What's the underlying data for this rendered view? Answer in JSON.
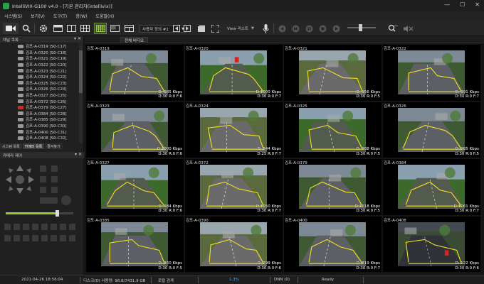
{
  "window": {
    "title": "IntelliVIX-G100 v4.0 - [기본 관리자(intellivix)]",
    "controls": [
      "—",
      "☐",
      "✕"
    ]
  },
  "menu": [
    "시스템(S)",
    "보기(V)",
    "도구(T)",
    "창(W)",
    "도움말(H)"
  ],
  "toolbar": {
    "layout_combo": "사용자 정의 #1",
    "view_label": "View 리스트"
  },
  "camera_list": {
    "header": "채널 목록",
    "items": [
      {
        "label": "김포-A-0319 [S0-C17]",
        "alert": false
      },
      {
        "label": "김포-A-0320 [S0-C18]",
        "alert": false
      },
      {
        "label": "김포-A-0321 [S0-C19]",
        "alert": false
      },
      {
        "label": "김포-A-0322 [S0-C20]",
        "alert": false
      },
      {
        "label": "김포-A-0323 [S0-C21]",
        "alert": false
      },
      {
        "label": "김포-A-0324 [S0-C22]",
        "alert": false
      },
      {
        "label": "김포-A-0325 [S0-C23]",
        "alert": false
      },
      {
        "label": "김포-A-0326 [S0-C24]",
        "alert": false
      },
      {
        "label": "김포-A-0327 [S0-C25]",
        "alert": false
      },
      {
        "label": "김포-A-0372 [S0-C26]",
        "alert": false
      },
      {
        "label": "김포-A-0379 [S0-C27]",
        "alert": true
      },
      {
        "label": "김포-A-0384 [S0-C28]",
        "alert": false
      },
      {
        "label": "김포-A-0385 [S0-C29]",
        "alert": false
      },
      {
        "label": "김포-A-0390 [S0-C30]",
        "alert": false
      },
      {
        "label": "김포-A-0400 [S0-C31]",
        "alert": false
      },
      {
        "label": "김포-A-0408 [S0-C32]",
        "alert": false
      }
    ]
  },
  "left_tabs": [
    "시스템 목록",
    "카메라 목록",
    "즐겨찾기"
  ],
  "ptz": {
    "header": "카메라 제어"
  },
  "main_tab": "전체 비디오",
  "cells": [
    {
      "name": "김포-A-0319",
      "stats": [
        "D: 985 Kbps",
        "D:30 R:0 F:6"
      ],
      "scene": "road"
    },
    {
      "name": "김포-A-0320",
      "stats": [
        "D:1000 Kbps",
        "D:30 R:0 F:7"
      ],
      "scene": "trees"
    },
    {
      "name": "김포-A-0321",
      "stats": [
        "D: 956 Kbps",
        "D:30 R:0 F:5"
      ],
      "scene": "street"
    },
    {
      "name": "김포-A-0322",
      "stats": [
        "D: 991 Kbps",
        "D:30 R:0 F:7"
      ],
      "scene": "road"
    },
    {
      "name": "김포-A-0323",
      "stats": [
        "D:1000 Kbps",
        "D:30 R:0 F:6"
      ],
      "scene": "road"
    },
    {
      "name": "김포-A-0324",
      "stats": [
        "D: 844 Kbps",
        "D:25 R:0 F:7"
      ],
      "scene": "street"
    },
    {
      "name": "김포-A-0325",
      "stats": [
        "D: 988 Kbps",
        "D:30 R:0 F:5"
      ],
      "scene": "trees"
    },
    {
      "name": "김포-A-0326",
      "stats": [
        "D: 985 Kbps",
        "D:30 R:0 F:5"
      ],
      "scene": "road"
    },
    {
      "name": "김포-A-0327",
      "stats": [
        "D: 984 Kbps",
        "D:30 R:0 F:6"
      ],
      "scene": "trees"
    },
    {
      "name": "김포-A-0372",
      "stats": [
        "D:1050 Kbps",
        "D:30 R:0 F:7"
      ],
      "scene": "street"
    },
    {
      "name": "김포-A-0379",
      "stats": [
        "D:1018 Kbps",
        "D:30 R:0 F:5"
      ],
      "scene": "road"
    },
    {
      "name": "김포-A-0384",
      "stats": [
        "D:1061 Kbps",
        "D:30 R:0 F:7"
      ],
      "scene": "trees"
    },
    {
      "name": "김포-A-0385",
      "stats": [
        "D: 360 Kbps",
        "D:30 R:0 F:5"
      ],
      "scene": "road"
    },
    {
      "name": "김포-A-0390",
      "stats": [
        "D: 299 Kbps",
        "D:30 R:0 F:6"
      ],
      "scene": "street"
    },
    {
      "name": "김포-A-0400",
      "stats": [
        "D: 819 Kbps",
        "D:30 R:0 F:7"
      ],
      "scene": "road"
    },
    {
      "name": "김포-A-0408",
      "stats": [
        "D: 122 Kbps",
        "D:30 R:0 F:6"
      ],
      "scene": "night"
    }
  ],
  "status": {
    "datetime": "2021-04-26 18:56:04",
    "disk": "디스크(D) 사용량: 98.8/7431.9 GB",
    "search": "로컬 검색",
    "cpu": "1.3%",
    "dnn": "DNN (0)",
    "ready": "Ready"
  },
  "colors": {
    "zone_outline": "#f0e020",
    "alert": "#e02020",
    "accent_green": "#2e9e4c"
  }
}
